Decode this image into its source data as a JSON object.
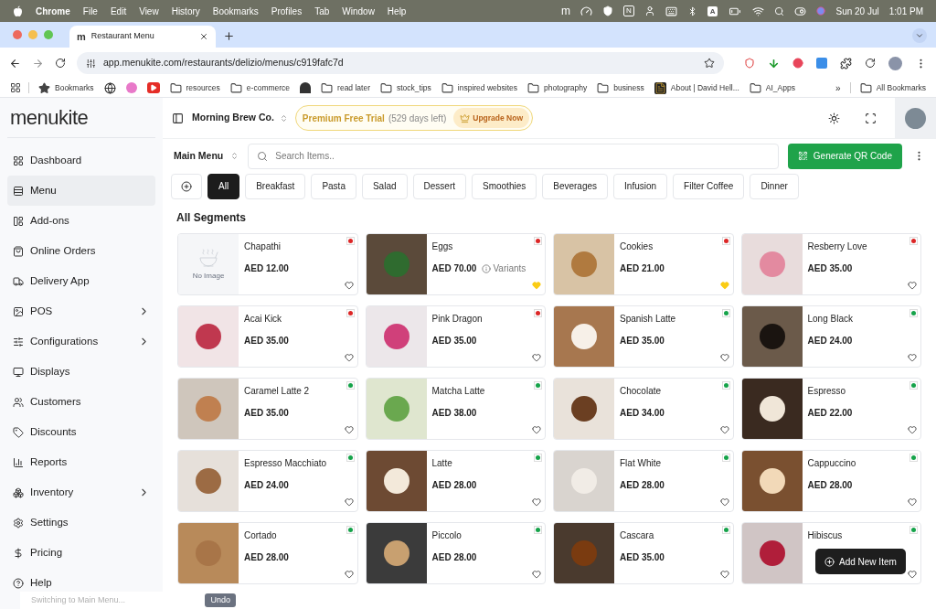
{
  "menu_bar": {
    "app": "Chrome",
    "menus": [
      "File",
      "Edit",
      "View",
      "History",
      "Bookmarks",
      "Profiles",
      "Tab",
      "Window",
      "Help"
    ],
    "status_texts": [
      "m",
      "N",
      "A"
    ],
    "date": "Sun 20 Jul",
    "time": "1:01 PM"
  },
  "browser": {
    "tabs": [
      {
        "favicon": "m",
        "title": "Restaurant Menu",
        "selected": true
      }
    ],
    "url": "app.menukite.com/restaurants/delizio/menus/c919fafc7d",
    "bookmarks": [
      {
        "kind": "star",
        "label": "Bookmarks"
      },
      {
        "kind": "globe"
      },
      {
        "kind": "dot"
      },
      {
        "kind": "video"
      },
      {
        "kind": "folder",
        "label": "resources"
      },
      {
        "kind": "folder",
        "label": "e-commerce"
      },
      {
        "kind": "hat"
      },
      {
        "kind": "folder",
        "label": "read later"
      },
      {
        "kind": "folder",
        "label": "stock_tips"
      },
      {
        "kind": "folder",
        "label": "inspired websites"
      },
      {
        "kind": "folder",
        "label": "photography"
      },
      {
        "kind": "folder",
        "label": "business"
      },
      {
        "kind": "page",
        "label": "About | David Hell..."
      },
      {
        "kind": "folder",
        "label": "AI_Apps"
      }
    ],
    "more": "»",
    "all_bookmarks": "All Bookmarks"
  },
  "app": {
    "logo": "menukite",
    "sidebar": [
      {
        "label": "Dashboard",
        "selected": false,
        "has_submenu": false
      },
      {
        "label": "Menu",
        "selected": true,
        "has_submenu": false
      },
      {
        "label": "Add-ons",
        "selected": false,
        "has_submenu": false
      },
      {
        "label": "Online Orders",
        "selected": false,
        "has_submenu": false
      },
      {
        "label": "Delivery App",
        "selected": false,
        "has_submenu": false
      },
      {
        "label": "POS",
        "selected": false,
        "has_submenu": true
      },
      {
        "label": "Configurations",
        "selected": false,
        "has_submenu": true
      },
      {
        "label": "Displays",
        "selected": false,
        "has_submenu": false
      },
      {
        "label": "Customers",
        "selected": false,
        "has_submenu": false
      },
      {
        "label": "Discounts",
        "selected": false,
        "has_submenu": false
      },
      {
        "label": "Reports",
        "selected": false,
        "has_submenu": false
      },
      {
        "label": "Inventory",
        "selected": false,
        "has_submenu": true
      },
      {
        "label": "Settings",
        "selected": false,
        "has_submenu": false
      },
      {
        "label": "Pricing",
        "selected": false,
        "has_submenu": false
      },
      {
        "label": "Help",
        "selected": false,
        "has_submenu": false
      }
    ],
    "header": {
      "restaurant": "Morning Brew Co.",
      "trial_plan": "Premium Free Trial",
      "trial_days": "(529 days left)",
      "upgrade": "Upgrade Now"
    },
    "toolbar": {
      "menu": "Main Menu",
      "search_placeholder": "Search Items..",
      "qr_button": "Generate QR Code"
    },
    "categories": [
      {
        "label": "All",
        "selected": true
      },
      {
        "label": "Breakfast",
        "selected": false
      },
      {
        "label": "Pasta",
        "selected": false
      },
      {
        "label": "Salad",
        "selected": false
      },
      {
        "label": "Dessert",
        "selected": false
      },
      {
        "label": "Smoothies",
        "selected": false
      },
      {
        "label": "Beverages",
        "selected": false
      },
      {
        "label": "Infusion",
        "selected": false
      },
      {
        "label": "Filter Coffee",
        "selected": false
      },
      {
        "label": "Dinner",
        "selected": false
      }
    ],
    "section_title": "All Segments",
    "items": [
      {
        "name": "Chapathi",
        "price": "AED 12.00",
        "color": "#dc2626",
        "favorite": false,
        "image": {
          "kind": "none",
          "label": "No Image"
        }
      },
      {
        "name": "Eggs",
        "price": "AED 70.00",
        "variants": "Variants",
        "color": "#dc2626",
        "favorite": true,
        "image": {
          "kind": "photo"
        }
      },
      {
        "name": "Cookies",
        "price": "AED 21.00",
        "color": "#dc2626",
        "favorite": true,
        "image": {
          "kind": "photo"
        }
      },
      {
        "name": "Resberry Love",
        "price": "AED 35.00",
        "color": "#dc2626",
        "favorite": false,
        "image": {
          "kind": "photo"
        }
      },
      {
        "name": "Acai Kick",
        "price": "AED 35.00",
        "color": "#dc2626",
        "favorite": false,
        "image": {
          "kind": "photo"
        }
      },
      {
        "name": "Pink Dragon",
        "price": "AED 35.00",
        "color": "#dc2626",
        "favorite": false,
        "image": {
          "kind": "photo"
        }
      },
      {
        "name": "Spanish Latte",
        "price": "AED 35.00",
        "color": "#16a34a",
        "favorite": false,
        "image": {
          "kind": "photo"
        }
      },
      {
        "name": "Long Black",
        "price": "AED 24.00",
        "color": "#16a34a",
        "favorite": false,
        "image": {
          "kind": "photo"
        }
      },
      {
        "name": "Caramel Latte 2",
        "price": "AED 35.00",
        "color": "#16a34a",
        "favorite": false,
        "image": {
          "kind": "photo"
        }
      },
      {
        "name": "Matcha Latte",
        "price": "AED 38.00",
        "color": "#16a34a",
        "favorite": false,
        "image": {
          "kind": "photo"
        }
      },
      {
        "name": "Chocolate",
        "price": "AED 34.00",
        "color": "#16a34a",
        "favorite": false,
        "image": {
          "kind": "photo"
        }
      },
      {
        "name": "Espresso",
        "price": "AED 22.00",
        "color": "#16a34a",
        "favorite": false,
        "image": {
          "kind": "photo"
        }
      },
      {
        "name": "Espresso Macchiato",
        "price": "AED 24.00",
        "color": "#16a34a",
        "favorite": false,
        "image": {
          "kind": "photo"
        }
      },
      {
        "name": "Latte",
        "price": "AED 28.00",
        "color": "#16a34a",
        "favorite": false,
        "image": {
          "kind": "photo"
        }
      },
      {
        "name": "Flat White",
        "price": "AED 28.00",
        "color": "#16a34a",
        "favorite": false,
        "image": {
          "kind": "photo"
        }
      },
      {
        "name": "Cappuccino",
        "price": "AED 28.00",
        "color": "#16a34a",
        "favorite": false,
        "image": {
          "kind": "photo"
        }
      },
      {
        "name": "Cortado",
        "price": "AED 28.00",
        "color": "#16a34a",
        "favorite": false,
        "image": {
          "kind": "photo"
        }
      },
      {
        "name": "Piccolo",
        "price": "AED 28.00",
        "color": "#16a34a",
        "favorite": false,
        "image": {
          "kind": "photo"
        }
      },
      {
        "name": "Cascara",
        "price": "AED 35.00",
        "color": "#16a34a",
        "favorite": false,
        "image": {
          "kind": "photo"
        }
      },
      {
        "name": "Hibiscus",
        "color": "#16a34a",
        "favorite": false,
        "image": {
          "kind": "photo"
        }
      }
    ],
    "add_button": "Add New Item",
    "toast": {
      "message": "Switching to Main Menu...",
      "action": "Undo"
    }
  }
}
